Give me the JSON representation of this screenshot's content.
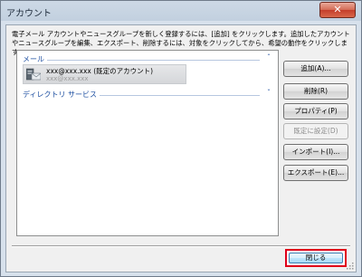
{
  "window": {
    "title": "アカウント",
    "close_glyph": "✕"
  },
  "description": "電子メール アカウントやニュースグループを新しく登録するには、[追加] をクリックします。追加したアカウントやニュースグループを編集、エクスポート、削除するには、対象をクリックしてから、希望の動作をクリックします。",
  "groups": {
    "mail": {
      "label": "メール",
      "chevron": "ˆ"
    },
    "directory": {
      "label": "ディレクトリ サービス",
      "chevron": "ˇ"
    }
  },
  "account": {
    "name": "xxx@xxx.xxx (既定のアカウント)",
    "sub": "xxx@xxx.xxx",
    "icon": "mail-account-icon"
  },
  "buttons": {
    "add": "追加(A)...",
    "remove": "削除(R)",
    "properties": "プロパティ(P)",
    "set_default": "既定に設定(D)",
    "import": "インポート(I)...",
    "export": "エクスポート(E)...",
    "close": "閉じる"
  },
  "colors": {
    "highlight_border": "#e0001a",
    "group_label": "#1e4fa1"
  }
}
